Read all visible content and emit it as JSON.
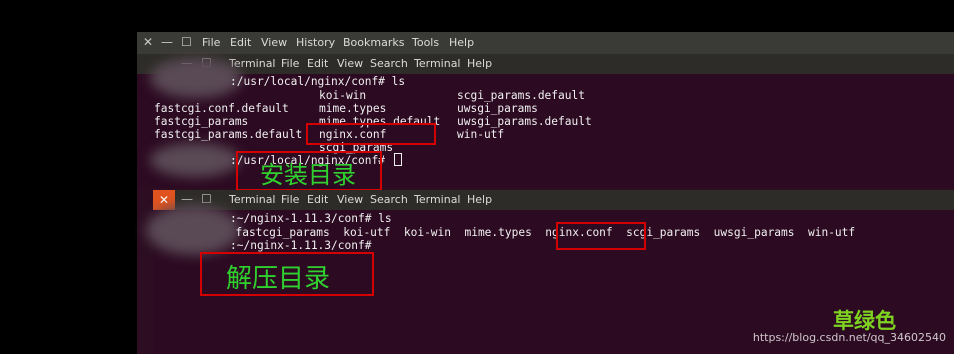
{
  "firefox_menu": {
    "window_controls": [
      "✕",
      "—",
      "☐"
    ],
    "items": [
      "File",
      "Edit",
      "View",
      "History",
      "Bookmarks",
      "Tools",
      "Help"
    ]
  },
  "terminal1": {
    "window_controls": [
      "—",
      "☐"
    ],
    "menu": [
      "Terminal",
      "File",
      "Edit",
      "View",
      "Search",
      "Terminal",
      "Help"
    ],
    "prompt1": ":/usr/local/nginx/conf# ls",
    "listing": [
      {
        "c1": "",
        "c2": "koi-win",
        "c3": "scgi_params.default"
      },
      {
        "c1": "fastcgi.conf.default",
        "c2": "mime.types",
        "c3": "uwsgi_params"
      },
      {
        "c1": "fastcgi_params",
        "c2": "mime.types.default",
        "c3": "uwsgi_params.default"
      },
      {
        "c1": "fastcgi_params.default",
        "c2": "nginx.conf",
        "c3": "win-utf"
      },
      {
        "c1": "",
        "c2": "scgi_params",
        "c3": ""
      }
    ],
    "prompt2": ":/usr/local/nginx/conf#",
    "annotation": "安装目录"
  },
  "terminal2": {
    "close_symbol": "✕",
    "window_controls": [
      "—",
      "☐"
    ],
    "menu": [
      "Terminal",
      "File",
      "Edit",
      "View",
      "Search",
      "Terminal",
      "Help"
    ],
    "prompt1": ":~/nginx-1.11.3/conf# ls",
    "listing": "  fastcgi_params  koi-utf  koi-win  mime.types  nginx.conf  scgi_params  uwsgi_params  win-utf",
    "prompt2": ":~/nginx-1.11.3/conf#",
    "annotation": "解压目录"
  },
  "footer": {
    "logo": "草绿色",
    "watermark": "https://blog.csdn.net/qq_34602540"
  }
}
